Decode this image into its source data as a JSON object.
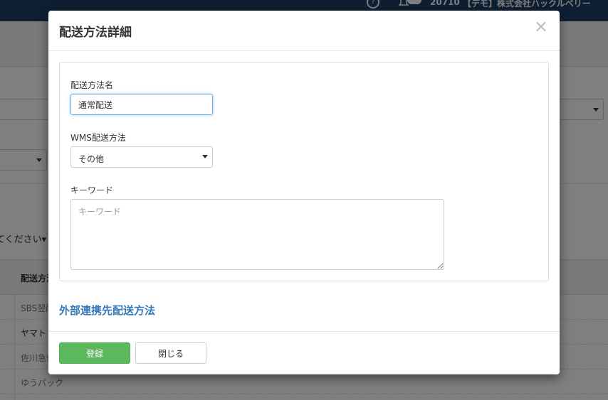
{
  "background": {
    "header": {
      "help_icon_glyph": "?",
      "user_code": "20710",
      "company": "【デモ】株式会社ハックルベリー"
    },
    "filter_label": "てください▾",
    "table": {
      "header": "配送方法",
      "rows": [
        "SBS翌配",
        "ヤマト",
        "佐川急便",
        "ゆうパック"
      ]
    }
  },
  "modal": {
    "title": "配送方法詳細",
    "close_glyph": "×",
    "form": {
      "name_label": "配送方法名",
      "name_value": "通常配送",
      "wms_label": "WMS配送方法",
      "wms_value": "その他",
      "keyword_label": "キーワード",
      "keyword_placeholder": "キーワード"
    },
    "external_link": "外部連携先配送方法",
    "footer": {
      "register_label": "登録",
      "close_label": "閉じる"
    }
  },
  "colors": {
    "primary_link": "#337ab7",
    "success": "#5cb85c",
    "topbar": "#1e3f66"
  }
}
